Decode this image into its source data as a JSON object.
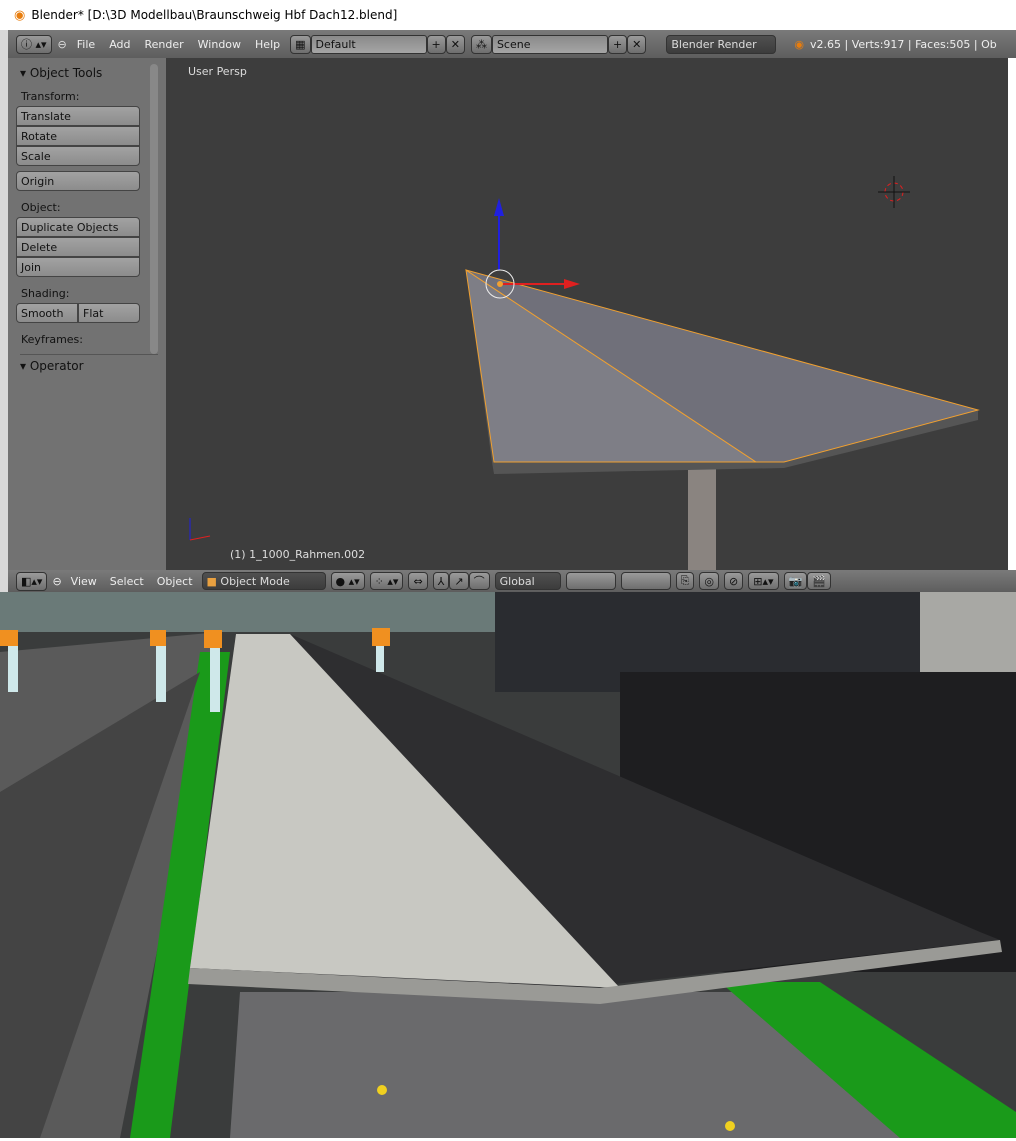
{
  "window": {
    "title": "Blender* [D:\\3D Modellbau\\Braunschweig Hbf Dach12.blend]"
  },
  "header": {
    "menus": [
      "File",
      "Add",
      "Render",
      "Window",
      "Help"
    ],
    "layout": "Default",
    "scene": "Scene",
    "engine": "Blender Render",
    "stats": "v2.65 | Verts:917 | Faces:505 | Ob"
  },
  "toolshelf": {
    "title": "Object Tools",
    "transform_label": "Transform:",
    "translate": "Translate",
    "rotate": "Rotate",
    "scale": "Scale",
    "origin": "Origin",
    "object_label": "Object:",
    "duplicate": "Duplicate Objects",
    "delete": "Delete",
    "join": "Join",
    "shading_label": "Shading:",
    "smooth": "Smooth",
    "flat": "Flat",
    "keyframes_label": "Keyframes:",
    "operator": "Operator"
  },
  "viewport": {
    "view_name": "User Persp",
    "object_name": "(1) 1_1000_Rahmen.002"
  },
  "view_header": {
    "menus": [
      "View",
      "Select",
      "Object"
    ],
    "mode": "Object Mode",
    "orientation": "Global"
  },
  "colors": {
    "accent": "#e87d0d",
    "selection": "#f0a030",
    "viewport_bg": "#3d3d3d"
  }
}
